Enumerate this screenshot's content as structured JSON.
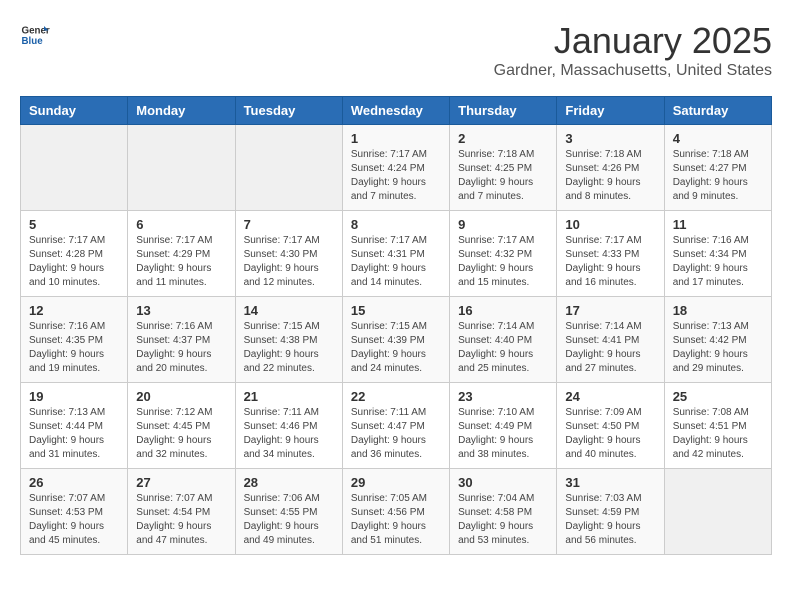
{
  "logo": {
    "general": "General",
    "blue": "Blue"
  },
  "title": "January 2025",
  "location": "Gardner, Massachusetts, United States",
  "days_of_week": [
    "Sunday",
    "Monday",
    "Tuesday",
    "Wednesday",
    "Thursday",
    "Friday",
    "Saturday"
  ],
  "weeks": [
    [
      {
        "day": "",
        "info": ""
      },
      {
        "day": "",
        "info": ""
      },
      {
        "day": "",
        "info": ""
      },
      {
        "day": "1",
        "info": "Sunrise: 7:17 AM\nSunset: 4:24 PM\nDaylight: 9 hours\nand 7 minutes."
      },
      {
        "day": "2",
        "info": "Sunrise: 7:18 AM\nSunset: 4:25 PM\nDaylight: 9 hours\nand 7 minutes."
      },
      {
        "day": "3",
        "info": "Sunrise: 7:18 AM\nSunset: 4:26 PM\nDaylight: 9 hours\nand 8 minutes."
      },
      {
        "day": "4",
        "info": "Sunrise: 7:18 AM\nSunset: 4:27 PM\nDaylight: 9 hours\nand 9 minutes."
      }
    ],
    [
      {
        "day": "5",
        "info": "Sunrise: 7:17 AM\nSunset: 4:28 PM\nDaylight: 9 hours\nand 10 minutes."
      },
      {
        "day": "6",
        "info": "Sunrise: 7:17 AM\nSunset: 4:29 PM\nDaylight: 9 hours\nand 11 minutes."
      },
      {
        "day": "7",
        "info": "Sunrise: 7:17 AM\nSunset: 4:30 PM\nDaylight: 9 hours\nand 12 minutes."
      },
      {
        "day": "8",
        "info": "Sunrise: 7:17 AM\nSunset: 4:31 PM\nDaylight: 9 hours\nand 14 minutes."
      },
      {
        "day": "9",
        "info": "Sunrise: 7:17 AM\nSunset: 4:32 PM\nDaylight: 9 hours\nand 15 minutes."
      },
      {
        "day": "10",
        "info": "Sunrise: 7:17 AM\nSunset: 4:33 PM\nDaylight: 9 hours\nand 16 minutes."
      },
      {
        "day": "11",
        "info": "Sunrise: 7:16 AM\nSunset: 4:34 PM\nDaylight: 9 hours\nand 17 minutes."
      }
    ],
    [
      {
        "day": "12",
        "info": "Sunrise: 7:16 AM\nSunset: 4:35 PM\nDaylight: 9 hours\nand 19 minutes."
      },
      {
        "day": "13",
        "info": "Sunrise: 7:16 AM\nSunset: 4:37 PM\nDaylight: 9 hours\nand 20 minutes."
      },
      {
        "day": "14",
        "info": "Sunrise: 7:15 AM\nSunset: 4:38 PM\nDaylight: 9 hours\nand 22 minutes."
      },
      {
        "day": "15",
        "info": "Sunrise: 7:15 AM\nSunset: 4:39 PM\nDaylight: 9 hours\nand 24 minutes."
      },
      {
        "day": "16",
        "info": "Sunrise: 7:14 AM\nSunset: 4:40 PM\nDaylight: 9 hours\nand 25 minutes."
      },
      {
        "day": "17",
        "info": "Sunrise: 7:14 AM\nSunset: 4:41 PM\nDaylight: 9 hours\nand 27 minutes."
      },
      {
        "day": "18",
        "info": "Sunrise: 7:13 AM\nSunset: 4:42 PM\nDaylight: 9 hours\nand 29 minutes."
      }
    ],
    [
      {
        "day": "19",
        "info": "Sunrise: 7:13 AM\nSunset: 4:44 PM\nDaylight: 9 hours\nand 31 minutes."
      },
      {
        "day": "20",
        "info": "Sunrise: 7:12 AM\nSunset: 4:45 PM\nDaylight: 9 hours\nand 32 minutes."
      },
      {
        "day": "21",
        "info": "Sunrise: 7:11 AM\nSunset: 4:46 PM\nDaylight: 9 hours\nand 34 minutes."
      },
      {
        "day": "22",
        "info": "Sunrise: 7:11 AM\nSunset: 4:47 PM\nDaylight: 9 hours\nand 36 minutes."
      },
      {
        "day": "23",
        "info": "Sunrise: 7:10 AM\nSunset: 4:49 PM\nDaylight: 9 hours\nand 38 minutes."
      },
      {
        "day": "24",
        "info": "Sunrise: 7:09 AM\nSunset: 4:50 PM\nDaylight: 9 hours\nand 40 minutes."
      },
      {
        "day": "25",
        "info": "Sunrise: 7:08 AM\nSunset: 4:51 PM\nDaylight: 9 hours\nand 42 minutes."
      }
    ],
    [
      {
        "day": "26",
        "info": "Sunrise: 7:07 AM\nSunset: 4:53 PM\nDaylight: 9 hours\nand 45 minutes."
      },
      {
        "day": "27",
        "info": "Sunrise: 7:07 AM\nSunset: 4:54 PM\nDaylight: 9 hours\nand 47 minutes."
      },
      {
        "day": "28",
        "info": "Sunrise: 7:06 AM\nSunset: 4:55 PM\nDaylight: 9 hours\nand 49 minutes."
      },
      {
        "day": "29",
        "info": "Sunrise: 7:05 AM\nSunset: 4:56 PM\nDaylight: 9 hours\nand 51 minutes."
      },
      {
        "day": "30",
        "info": "Sunrise: 7:04 AM\nSunset: 4:58 PM\nDaylight: 9 hours\nand 53 minutes."
      },
      {
        "day": "31",
        "info": "Sunrise: 7:03 AM\nSunset: 4:59 PM\nDaylight: 9 hours\nand 56 minutes."
      },
      {
        "day": "",
        "info": ""
      }
    ]
  ]
}
